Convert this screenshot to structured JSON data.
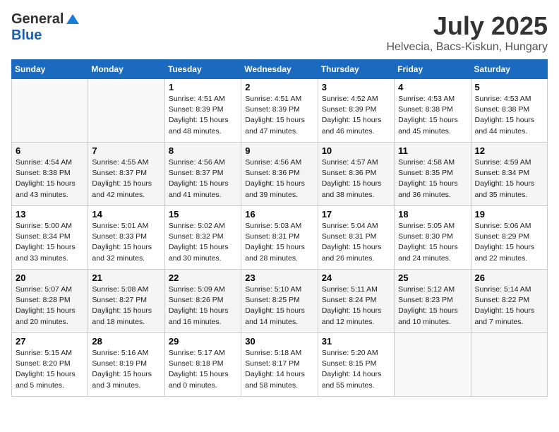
{
  "logo": {
    "general": "General",
    "blue": "Blue"
  },
  "title": "July 2025",
  "location": "Helvecia, Bacs-Kiskun, Hungary",
  "days_of_week": [
    "Sunday",
    "Monday",
    "Tuesday",
    "Wednesday",
    "Thursday",
    "Friday",
    "Saturday"
  ],
  "weeks": [
    [
      {
        "day": "",
        "sunrise": "",
        "sunset": "",
        "daylight": ""
      },
      {
        "day": "",
        "sunrise": "",
        "sunset": "",
        "daylight": ""
      },
      {
        "day": "1",
        "sunrise": "Sunrise: 4:51 AM",
        "sunset": "Sunset: 8:39 PM",
        "daylight": "Daylight: 15 hours and 48 minutes."
      },
      {
        "day": "2",
        "sunrise": "Sunrise: 4:51 AM",
        "sunset": "Sunset: 8:39 PM",
        "daylight": "Daylight: 15 hours and 47 minutes."
      },
      {
        "day": "3",
        "sunrise": "Sunrise: 4:52 AM",
        "sunset": "Sunset: 8:39 PM",
        "daylight": "Daylight: 15 hours and 46 minutes."
      },
      {
        "day": "4",
        "sunrise": "Sunrise: 4:53 AM",
        "sunset": "Sunset: 8:38 PM",
        "daylight": "Daylight: 15 hours and 45 minutes."
      },
      {
        "day": "5",
        "sunrise": "Sunrise: 4:53 AM",
        "sunset": "Sunset: 8:38 PM",
        "daylight": "Daylight: 15 hours and 44 minutes."
      }
    ],
    [
      {
        "day": "6",
        "sunrise": "Sunrise: 4:54 AM",
        "sunset": "Sunset: 8:38 PM",
        "daylight": "Daylight: 15 hours and 43 minutes."
      },
      {
        "day": "7",
        "sunrise": "Sunrise: 4:55 AM",
        "sunset": "Sunset: 8:37 PM",
        "daylight": "Daylight: 15 hours and 42 minutes."
      },
      {
        "day": "8",
        "sunrise": "Sunrise: 4:56 AM",
        "sunset": "Sunset: 8:37 PM",
        "daylight": "Daylight: 15 hours and 41 minutes."
      },
      {
        "day": "9",
        "sunrise": "Sunrise: 4:56 AM",
        "sunset": "Sunset: 8:36 PM",
        "daylight": "Daylight: 15 hours and 39 minutes."
      },
      {
        "day": "10",
        "sunrise": "Sunrise: 4:57 AM",
        "sunset": "Sunset: 8:36 PM",
        "daylight": "Daylight: 15 hours and 38 minutes."
      },
      {
        "day": "11",
        "sunrise": "Sunrise: 4:58 AM",
        "sunset": "Sunset: 8:35 PM",
        "daylight": "Daylight: 15 hours and 36 minutes."
      },
      {
        "day": "12",
        "sunrise": "Sunrise: 4:59 AM",
        "sunset": "Sunset: 8:34 PM",
        "daylight": "Daylight: 15 hours and 35 minutes."
      }
    ],
    [
      {
        "day": "13",
        "sunrise": "Sunrise: 5:00 AM",
        "sunset": "Sunset: 8:34 PM",
        "daylight": "Daylight: 15 hours and 33 minutes."
      },
      {
        "day": "14",
        "sunrise": "Sunrise: 5:01 AM",
        "sunset": "Sunset: 8:33 PM",
        "daylight": "Daylight: 15 hours and 32 minutes."
      },
      {
        "day": "15",
        "sunrise": "Sunrise: 5:02 AM",
        "sunset": "Sunset: 8:32 PM",
        "daylight": "Daylight: 15 hours and 30 minutes."
      },
      {
        "day": "16",
        "sunrise": "Sunrise: 5:03 AM",
        "sunset": "Sunset: 8:31 PM",
        "daylight": "Daylight: 15 hours and 28 minutes."
      },
      {
        "day": "17",
        "sunrise": "Sunrise: 5:04 AM",
        "sunset": "Sunset: 8:31 PM",
        "daylight": "Daylight: 15 hours and 26 minutes."
      },
      {
        "day": "18",
        "sunrise": "Sunrise: 5:05 AM",
        "sunset": "Sunset: 8:30 PM",
        "daylight": "Daylight: 15 hours and 24 minutes."
      },
      {
        "day": "19",
        "sunrise": "Sunrise: 5:06 AM",
        "sunset": "Sunset: 8:29 PM",
        "daylight": "Daylight: 15 hours and 22 minutes."
      }
    ],
    [
      {
        "day": "20",
        "sunrise": "Sunrise: 5:07 AM",
        "sunset": "Sunset: 8:28 PM",
        "daylight": "Daylight: 15 hours and 20 minutes."
      },
      {
        "day": "21",
        "sunrise": "Sunrise: 5:08 AM",
        "sunset": "Sunset: 8:27 PM",
        "daylight": "Daylight: 15 hours and 18 minutes."
      },
      {
        "day": "22",
        "sunrise": "Sunrise: 5:09 AM",
        "sunset": "Sunset: 8:26 PM",
        "daylight": "Daylight: 15 hours and 16 minutes."
      },
      {
        "day": "23",
        "sunrise": "Sunrise: 5:10 AM",
        "sunset": "Sunset: 8:25 PM",
        "daylight": "Daylight: 15 hours and 14 minutes."
      },
      {
        "day": "24",
        "sunrise": "Sunrise: 5:11 AM",
        "sunset": "Sunset: 8:24 PM",
        "daylight": "Daylight: 15 hours and 12 minutes."
      },
      {
        "day": "25",
        "sunrise": "Sunrise: 5:12 AM",
        "sunset": "Sunset: 8:23 PM",
        "daylight": "Daylight: 15 hours and 10 minutes."
      },
      {
        "day": "26",
        "sunrise": "Sunrise: 5:14 AM",
        "sunset": "Sunset: 8:22 PM",
        "daylight": "Daylight: 15 hours and 7 minutes."
      }
    ],
    [
      {
        "day": "27",
        "sunrise": "Sunrise: 5:15 AM",
        "sunset": "Sunset: 8:20 PM",
        "daylight": "Daylight: 15 hours and 5 minutes."
      },
      {
        "day": "28",
        "sunrise": "Sunrise: 5:16 AM",
        "sunset": "Sunset: 8:19 PM",
        "daylight": "Daylight: 15 hours and 3 minutes."
      },
      {
        "day": "29",
        "sunrise": "Sunrise: 5:17 AM",
        "sunset": "Sunset: 8:18 PM",
        "daylight": "Daylight: 15 hours and 0 minutes."
      },
      {
        "day": "30",
        "sunrise": "Sunrise: 5:18 AM",
        "sunset": "Sunset: 8:17 PM",
        "daylight": "Daylight: 14 hours and 58 minutes."
      },
      {
        "day": "31",
        "sunrise": "Sunrise: 5:20 AM",
        "sunset": "Sunset: 8:15 PM",
        "daylight": "Daylight: 14 hours and 55 minutes."
      },
      {
        "day": "",
        "sunrise": "",
        "sunset": "",
        "daylight": ""
      },
      {
        "day": "",
        "sunrise": "",
        "sunset": "",
        "daylight": ""
      }
    ]
  ]
}
